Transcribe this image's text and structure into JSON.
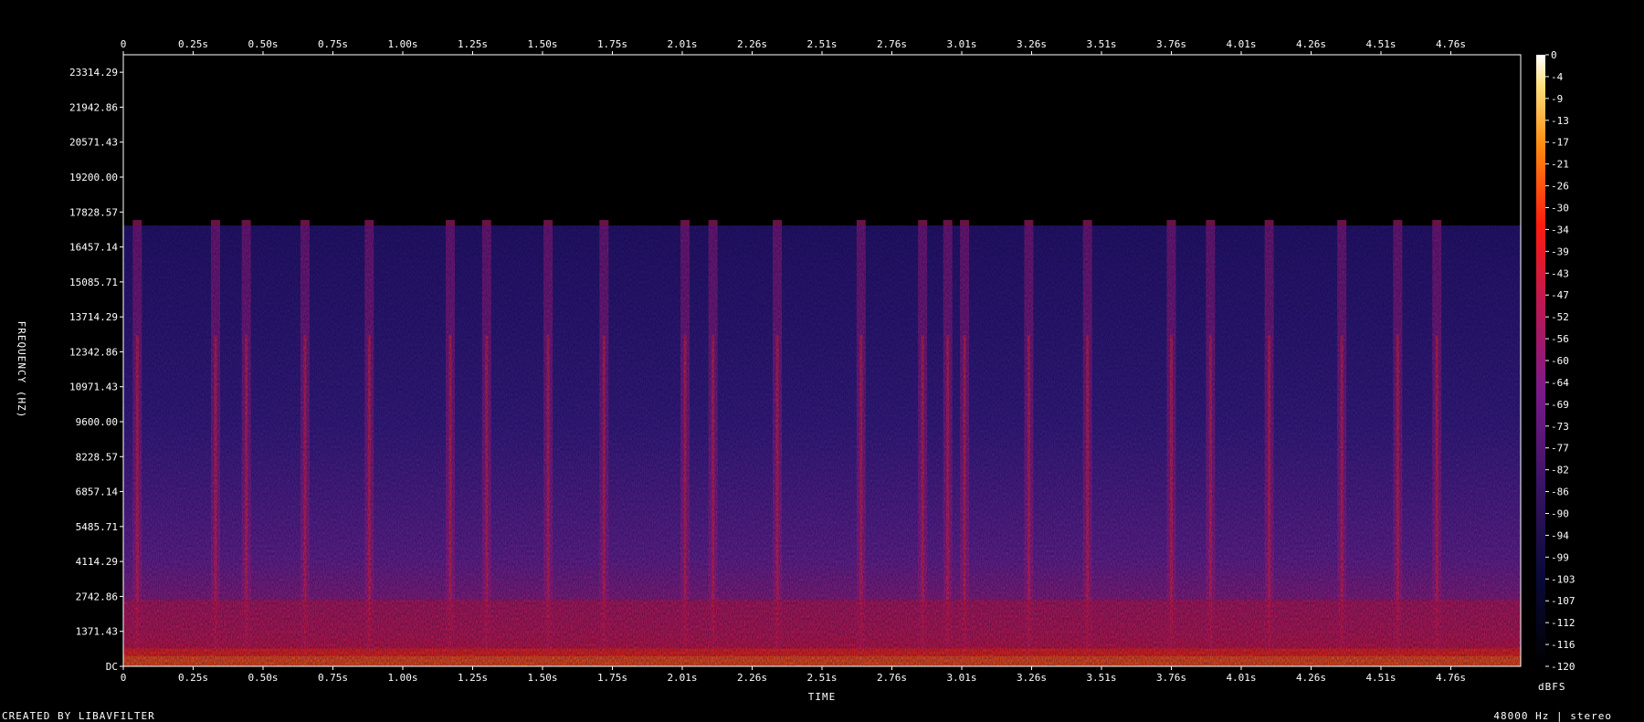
{
  "chart_data": {
    "type": "heatmap",
    "xlabel": "TIME",
    "ylabel": "FREQUENCY (HZ)",
    "x_ticks": [
      "0",
      "0.25s",
      "0.50s",
      "0.75s",
      "1.00s",
      "1.25s",
      "1.50s",
      "1.75s",
      "2.01s",
      "2.26s",
      "2.51s",
      "2.76s",
      "3.01s",
      "3.26s",
      "3.51s",
      "3.76s",
      "4.01s",
      "4.26s",
      "4.51s",
      "4.76s"
    ],
    "y_ticks": [
      "DC",
      "1371.43",
      "2742.86",
      "4114.29",
      "5485.71",
      "6857.14",
      "8228.57",
      "9600.00",
      "10971.43",
      "12342.86",
      "13714.29",
      "15085.71",
      "16457.14",
      "17828.57",
      "19200.00",
      "20571.43",
      "21942.86",
      "23314.29"
    ],
    "y_tick_values": [
      0,
      1371.43,
      2742.86,
      4114.29,
      5485.71,
      6857.14,
      8228.57,
      9600,
      10971.43,
      12342.86,
      13714.29,
      15085.71,
      16457.14,
      17828.57,
      19200,
      20571.43,
      21942.86,
      23314.29
    ],
    "x_range": [
      0,
      5.0
    ],
    "y_range": [
      0,
      24000
    ],
    "colorbar": {
      "label": "dBFS",
      "ticks": [
        "0",
        "-4",
        "-9",
        "-13",
        "-17",
        "-21",
        "-26",
        "-30",
        "-34",
        "-39",
        "-43",
        "-47",
        "-52",
        "-56",
        "-60",
        "-64",
        "-69",
        "-73",
        "-77",
        "-82",
        "-86",
        "-90",
        "-94",
        "-99",
        "-103",
        "-107",
        "-112",
        "-116",
        "-120"
      ],
      "range": [
        -120,
        0
      ]
    },
    "spectral_cutoff_hz": 17300,
    "transient_times_s": [
      0.05,
      0.33,
      0.44,
      0.65,
      0.88,
      1.17,
      1.3,
      1.52,
      1.72,
      2.01,
      2.11,
      2.34,
      2.64,
      2.86,
      2.95,
      3.01,
      3.24,
      3.45,
      3.75,
      3.89,
      4.1,
      4.36,
      4.56,
      4.7
    ]
  },
  "footer": {
    "credit": "CREATED BY LIBAVFILTER",
    "info": "48000 Hz | stereo"
  }
}
